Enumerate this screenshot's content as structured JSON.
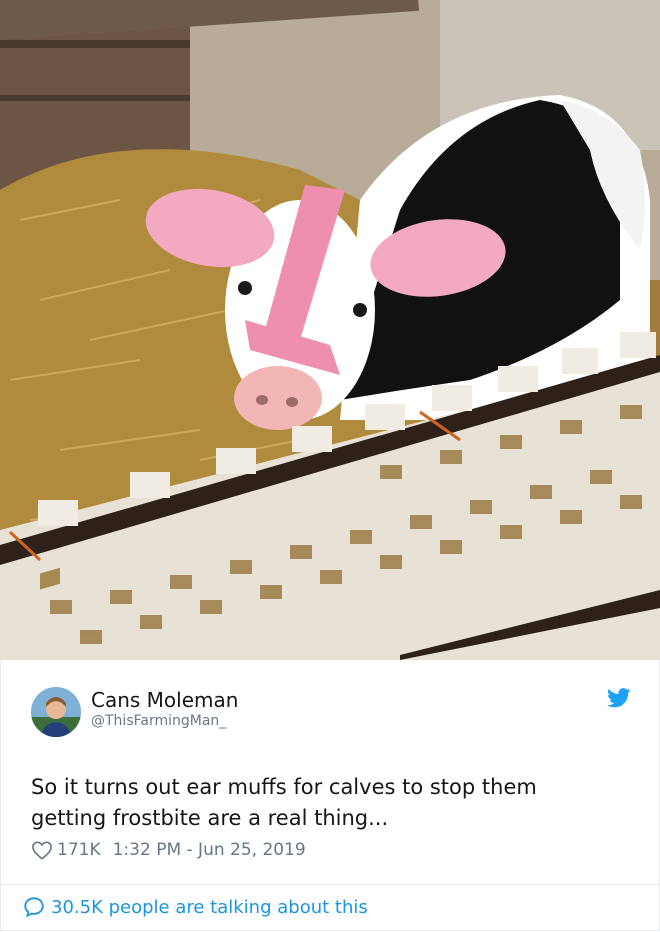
{
  "photo": {
    "alt_name": "calf-photo"
  },
  "tweet": {
    "author_name": "Cans Moleman",
    "author_handle": "@ThisFarmingMan_",
    "text_line1": "So it turns out ear muffs for calves to stop them",
    "text_line2": "getting frostbite are a real thing...",
    "likes": "171K",
    "timestamp": "1:32 PM - Jun 25, 2019",
    "talking": "30.5K people are talking about this"
  },
  "colors": {
    "twitter_blue": "#1da1f2",
    "link_blue": "#1b95e0",
    "muted": "#657786",
    "text": "#14171a"
  },
  "icons": {
    "bird": "twitter-bird-icon",
    "heart": "heart-icon",
    "reply": "speech-bubble-icon"
  }
}
